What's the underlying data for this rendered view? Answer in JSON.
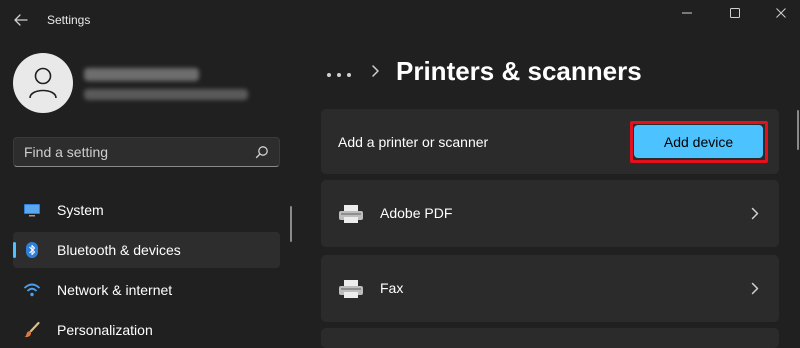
{
  "window": {
    "app_title": "Settings"
  },
  "breadcrumb": {
    "more": "•••",
    "page_title": "Printers & scanners"
  },
  "search": {
    "placeholder": "Find a setting"
  },
  "sidebar": {
    "items": [
      {
        "label": "System",
        "icon": "system-icon"
      },
      {
        "label": "Bluetooth & devices",
        "icon": "bluetooth-icon",
        "selected": true
      },
      {
        "label": "Network & internet",
        "icon": "wifi-icon"
      },
      {
        "label": "Personalization",
        "icon": "brush-icon"
      }
    ]
  },
  "main": {
    "add_card": {
      "label": "Add a printer or scanner",
      "button_label": "Add device"
    },
    "printers": [
      {
        "name": "Adobe PDF",
        "icon": "printer-icon"
      },
      {
        "name": "Fax",
        "icon": "printer-icon"
      }
    ]
  },
  "colors": {
    "background": "#202020",
    "card": "#2b2b2b",
    "accent": "#4cc2ff",
    "highlight": "#e5101e"
  }
}
